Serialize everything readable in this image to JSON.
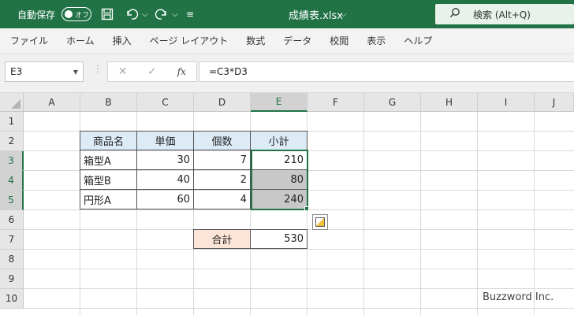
{
  "titlebar": {
    "autosave_label": "自動保存",
    "autosave_state": "オフ",
    "filename": "成績表.xlsx",
    "filename_caret": "⌵",
    "undo_caret": "⌵",
    "redo_caret": "⌵",
    "qat_more": "≡",
    "search_placeholder": "検索 (Alt+Q)",
    "icons": [
      "save-icon",
      "undo-icon",
      "redo-icon",
      "search-icon"
    ],
    "accent_color": "#217346"
  },
  "ribbon": {
    "tabs": [
      "ファイル",
      "ホーム",
      "挿入",
      "ページ レイアウト",
      "数式",
      "データ",
      "校閲",
      "表示",
      "ヘルプ"
    ]
  },
  "formula_bar": {
    "name_box": "E3",
    "fx_label": "fx",
    "cancel_glyph": "✕",
    "enter_glyph": "✓",
    "formula": "=C3*D3"
  },
  "grid": {
    "columns": [
      "A",
      "B",
      "C",
      "D",
      "E",
      "F",
      "G",
      "H",
      "I",
      "J"
    ],
    "rows": [
      "1",
      "2",
      "3",
      "4",
      "5",
      "6",
      "7",
      "8",
      "9",
      "10"
    ],
    "active_column": "E",
    "active_rows": [
      "3",
      "4",
      "5"
    ]
  },
  "table": {
    "headers": [
      "商品名",
      "単価",
      "個数",
      "小計"
    ],
    "rows": [
      {
        "name": "箱型A",
        "price": "30",
        "qty": "7",
        "subtotal": "210"
      },
      {
        "name": "箱型B",
        "price": "40",
        "qty": "2",
        "subtotal": "80"
      },
      {
        "name": "円形A",
        "price": "60",
        "qty": "4",
        "subtotal": "240"
      }
    ],
    "total_label": "合計",
    "total_value": "530",
    "header_color": "#ddebf7",
    "total_label_color": "#fce4d6"
  },
  "watermark": "Buzzword Inc."
}
